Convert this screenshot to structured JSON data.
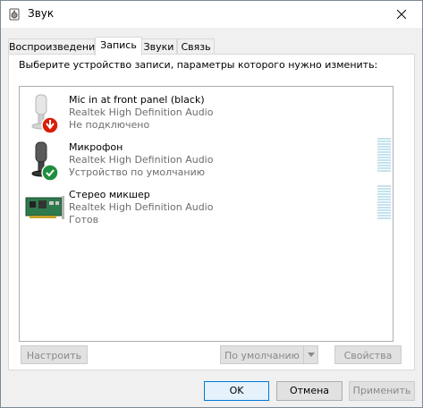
{
  "window": {
    "title": "Звук"
  },
  "tabs": [
    {
      "label": "Воспроизведение",
      "active": false
    },
    {
      "label": "Запись",
      "active": true
    },
    {
      "label": "Звуки",
      "active": false
    },
    {
      "label": "Связь",
      "active": false
    }
  ],
  "instruction": "Выберите устройство записи, параметры которого нужно изменить:",
  "devices": [
    {
      "name": "Mic in at front panel (black)",
      "driver": "Realtek High Definition Audio",
      "status": "Не подключено",
      "icon": "microphone-disconnected-icon"
    },
    {
      "name": "Микрофон",
      "driver": "Realtek High Definition Audio",
      "status": "Устройство по умолчанию",
      "icon": "microphone-default-icon"
    },
    {
      "name": "Стерео микшер",
      "driver": "Realtek High Definition Audio",
      "status": "Готов",
      "icon": "sound-card-icon"
    }
  ],
  "buttons": {
    "configure": "Настроить",
    "set_default": "По умолчанию",
    "properties": "Свойства",
    "ok": "OK",
    "cancel": "Отмена",
    "apply": "Применить"
  },
  "colors": {
    "accent": "#0078d7",
    "status_green": "#1e8e3e",
    "status_red": "#d81e06",
    "meter": "#c5e2ee"
  }
}
